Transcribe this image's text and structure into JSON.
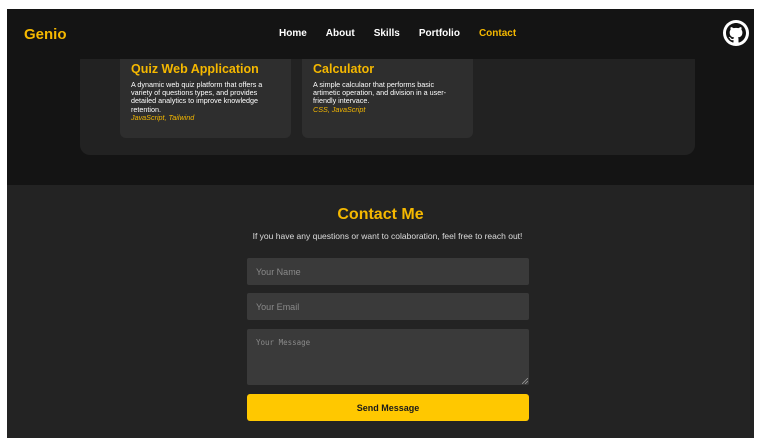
{
  "navbar": {
    "brand": "Genio",
    "links": [
      "Home",
      "About",
      "Skills",
      "Portfolio",
      "Contact"
    ],
    "active_link": "Contact",
    "github_icon": "github-icon"
  },
  "projects": [
    {
      "title": "Quiz Web Application",
      "description": "A dynamic web quiz platform that offers a variety of questions types, and provides detailed analytics to improve knowledge retention.",
      "tags": "JavaScript, Tailwind"
    },
    {
      "title": "Calculator",
      "description": "A simple calculaor that performs basic artimetic operation, and division in a user-friendly intervace.",
      "tags": "CSS, JavaScript"
    }
  ],
  "contact": {
    "title": "Contact Me",
    "subtitle": "If you have any questions or want to colaboration, feel free to reach out!",
    "name_placeholder": "Your Name",
    "email_placeholder": "Your Email",
    "message_placeholder": "Your Message",
    "send_label": "Send Message"
  },
  "colors": {
    "accent": "#f5b800",
    "button": "#ffc800",
    "background_dark": "#141414",
    "section_dark": "#232323",
    "card": "#2e2e2e",
    "input": "#3a3a3a"
  }
}
